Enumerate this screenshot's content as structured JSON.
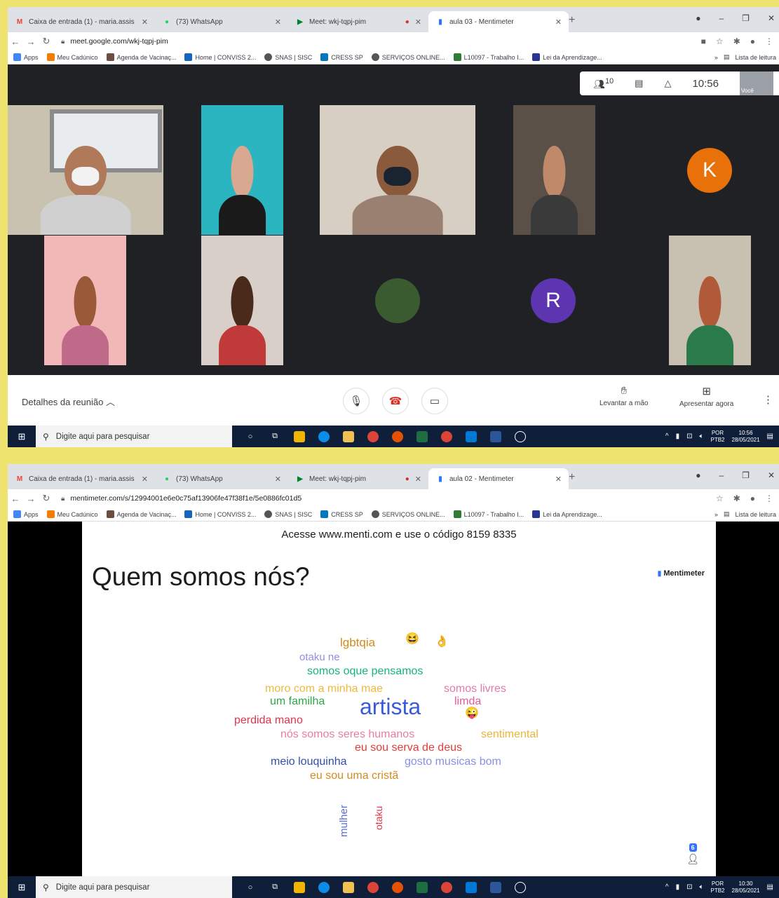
{
  "shot1": {
    "tabs": [
      {
        "icon": "gmail-icon",
        "label": "Caixa de entrada (1) - maria.assis",
        "color": "#ea4335"
      },
      {
        "icon": "whatsapp-icon",
        "label": "(73) WhatsApp",
        "color": "#25d366"
      },
      {
        "icon": "meet-icon",
        "label": "Meet: wkj-tqpj-pim",
        "color": "#00832d"
      },
      {
        "icon": "mentimeter-icon",
        "label": "aula 03 - Mentimeter",
        "color": "#2f74ff"
      }
    ],
    "url": "meet.google.com/wkj-tqpj-pim",
    "meet": {
      "clock": "10:56",
      "participants": "10",
      "you_label": "Você",
      "avatar_k": "K",
      "avatar_r": "R",
      "details": "Detalhes da reunião",
      "raise_hand": "Levantar a mão",
      "present_now": "Apresentar agora"
    },
    "taskbar": {
      "time": "10:56",
      "date": "28/05/2021"
    }
  },
  "shot2": {
    "tabs": [
      {
        "icon": "gmail-icon",
        "label": "Caixa de entrada (1) - maria.assis",
        "color": "#ea4335"
      },
      {
        "icon": "whatsapp-icon",
        "label": "(73) WhatsApp",
        "color": "#25d366"
      },
      {
        "icon": "meet-icon",
        "label": "Meet: wkj-tqpj-pim",
        "color": "#00832d"
      },
      {
        "icon": "mentimeter-icon",
        "label": "aula 02 - Mentimeter",
        "color": "#2f74ff"
      }
    ],
    "url": "mentimeter.com/s/12994001e6e0c75af13906fe47f38f1e/5e0886fc01d5",
    "menti": {
      "access": "Acesse www.menti.com e use o código 8159 8335",
      "title": "Quem somos nós?",
      "logo": "Mentimeter",
      "responses": "6",
      "words": [
        {
          "text": "lgbtqia",
          "color": "#d38a1f"
        },
        {
          "text": "otaku ne",
          "color": "#8f8fe0"
        },
        {
          "text": "somos oque pensamos",
          "color": "#17b37a"
        },
        {
          "text": "moro com a minha mae",
          "color": "#f0b93a"
        },
        {
          "text": "somos livres",
          "color": "#e27aa8"
        },
        {
          "text": "um familha",
          "color": "#2ea848"
        },
        {
          "text": "limda",
          "color": "#e25a9a"
        },
        {
          "text": "artista",
          "color": "#3a5bd9"
        },
        {
          "text": "perdida mano",
          "color": "#e0344a"
        },
        {
          "text": "nós somos seres humanos",
          "color": "#e87e9e"
        },
        {
          "text": "sentimental",
          "color": "#eab63a"
        },
        {
          "text": "eu sou serva de deus",
          "color": "#e23b3b"
        },
        {
          "text": "meio louquinha",
          "color": "#2f4fb0"
        },
        {
          "text": "gosto musicas bom",
          "color": "#8a8ee8"
        },
        {
          "text": "eu sou uma cristã",
          "color": "#d38a1f"
        },
        {
          "text": "mulher",
          "color": "#5a6fd0"
        },
        {
          "text": "otaku",
          "color": "#e0344a"
        }
      ]
    },
    "taskbar": {
      "time": "10:30",
      "date": "28/05/2021"
    }
  },
  "common": {
    "bookmarks": [
      "Apps",
      "Meu Cadúnico",
      "Agenda de Vacinaç...",
      "Home | CONVISS 2...",
      "SNAS | SISC",
      "CRESS SP",
      "SERVIÇOS ONLINE...",
      "L10097 - Trabalho I...",
      "Lei da Aprendizage..."
    ],
    "reading_list": "Lista de leitura",
    "search_placeholder": "Digite aqui para pesquisar",
    "lang": "POR",
    "lang2": "PTB2"
  }
}
